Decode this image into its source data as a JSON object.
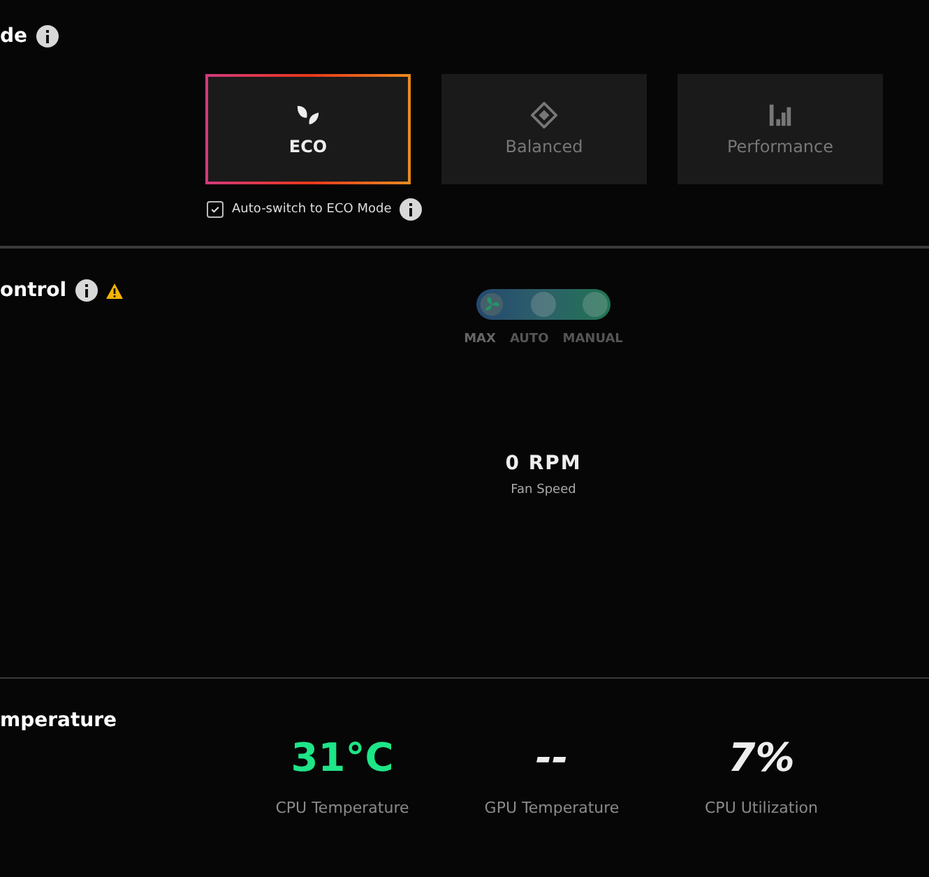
{
  "mode_section": {
    "heading": "de",
    "modes": [
      {
        "kind": "eco",
        "label": "ECO",
        "selected": true
      },
      {
        "kind": "balanced",
        "label": "Balanced",
        "selected": false
      },
      {
        "kind": "performance",
        "label": "Performance",
        "selected": false
      }
    ],
    "auto_switch": {
      "label": "Auto-switch to ECO Mode",
      "checked": true
    }
  },
  "fan_section": {
    "heading": "ontrol",
    "warning": true,
    "options": [
      {
        "label": "MAX",
        "selected": true
      },
      {
        "label": "AUTO",
        "selected": false
      },
      {
        "label": "MANUAL",
        "selected": false
      }
    ],
    "speed": "0 RPM",
    "speed_label": "Fan Speed"
  },
  "temp_section": {
    "heading": "mperature",
    "metrics": [
      {
        "kind": "good",
        "value": "31°C",
        "label": "CPU Temperature"
      },
      {
        "kind": "normal",
        "value": "--",
        "label": "GPU Temperature"
      },
      {
        "kind": "normal",
        "value": "7%",
        "label": "CPU Utilization"
      }
    ]
  }
}
